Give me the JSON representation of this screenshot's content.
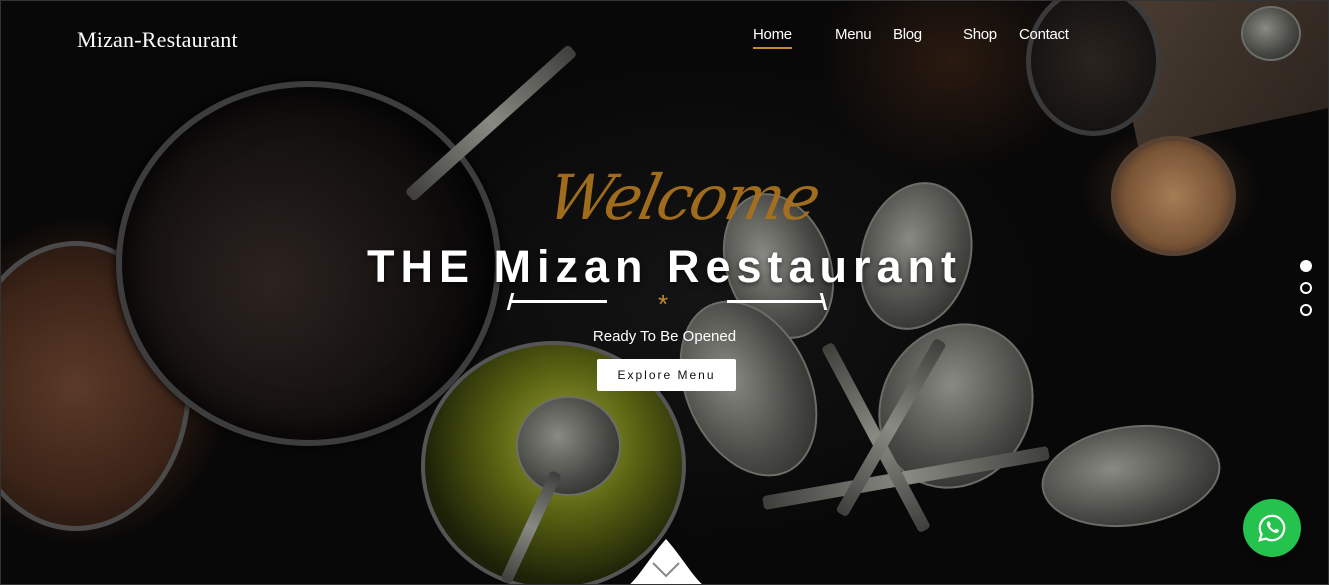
{
  "brand": {
    "logo_text": "Mizan-Restaurant"
  },
  "nav": {
    "items": [
      {
        "label": "Home",
        "active": true
      },
      {
        "label": "Menu",
        "active": false
      },
      {
        "label": "Blog",
        "active": false
      },
      {
        "label": "Shop",
        "active": false
      },
      {
        "label": "Contact",
        "active": false
      }
    ]
  },
  "hero": {
    "script_text": "Welcome",
    "title": "THE Mizan Restaurant",
    "divider_glyph": "*",
    "subtitle": "Ready To Be Opened",
    "cta_label": "Explore Menu"
  },
  "slider": {
    "slide_count": 3,
    "active_index": 0
  },
  "icons": {
    "whatsapp": "whatsapp-icon",
    "scroll_down": "chevron-down-icon"
  },
  "colors": {
    "accent": "#c68a2e",
    "script": "#a7711e",
    "whatsapp": "#25c24d",
    "background": "#070707"
  }
}
